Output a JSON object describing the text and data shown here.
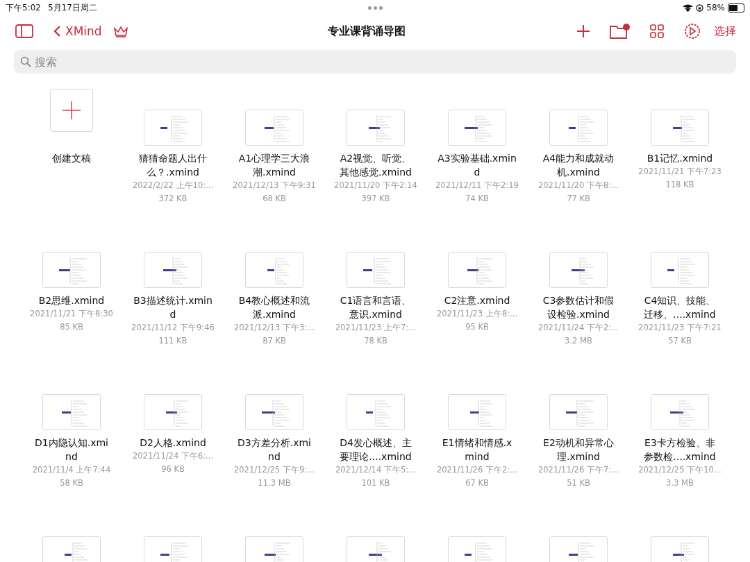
{
  "status_bar": {
    "time": "下午5:02",
    "date": "5月17日周二",
    "battery": "58%"
  },
  "nav": {
    "back_label": "XMind",
    "title": "专业课背诵导图",
    "select_label": "选择"
  },
  "search": {
    "placeholder": "搜索"
  },
  "create": {
    "label": "创建文稿"
  },
  "files": [
    {
      "kind": "file",
      "name": "猜猜命题人出什么？.xmind",
      "date": "2022/2/22 上午10:...",
      "size": "372 KB"
    },
    {
      "kind": "file",
      "name": "A1心理学三大浪潮.xmind",
      "date": "2021/12/13 下午9:31",
      "size": "68 KB"
    },
    {
      "kind": "file",
      "name": "A2视觉、听觉、其他感觉.xmind",
      "date": "2021/11/20 下午2:14",
      "size": "397 KB"
    },
    {
      "kind": "file",
      "name": "A3实验基础.xmind",
      "date": "2021/12/11 下午2:19",
      "size": "74 KB"
    },
    {
      "kind": "file",
      "name": "A4能力和成就动机.xmind",
      "date": "2021/11/20 下午8:...",
      "size": "77 KB"
    },
    {
      "kind": "file",
      "name": "B1记忆.xmind",
      "date": "2021/11/21 下午7:23",
      "size": "118 KB"
    },
    {
      "kind": "file",
      "name": "B2思维.xmind",
      "date": "2021/11/21 下午8:30",
      "size": "85 KB"
    },
    {
      "kind": "file",
      "name": "B3描述统计.xmind",
      "date": "2021/11/12 下午9:46",
      "size": "111 KB"
    },
    {
      "kind": "file",
      "name": "B4教心概述和流派.xmind",
      "date": "2021/12/13 下午3:...",
      "size": "87 KB"
    },
    {
      "kind": "file",
      "name": "C1语言和言语、意识.xmind",
      "date": "2021/11/23 上午7:...",
      "size": "78 KB"
    },
    {
      "kind": "file",
      "name": "C2注意.xmind",
      "date": "2021/11/23 上午8:...",
      "size": "95 KB"
    },
    {
      "kind": "file",
      "name": "C3参数估计和假设检验.xmind",
      "date": "2021/11/24 下午2:...",
      "size": "3.2 MB"
    },
    {
      "kind": "file",
      "name": "C4知识、技能、迁移、....xmind",
      "date": "2021/11/23 下午7:21",
      "size": "57 KB"
    },
    {
      "kind": "file",
      "name": "D1内隐认知.xmind",
      "date": "2021/11/4 上午7:44",
      "size": "58 KB"
    },
    {
      "kind": "file",
      "name": "D2人格.xmind",
      "date": "2021/11/24 下午6:...",
      "size": "96 KB"
    },
    {
      "kind": "file",
      "name": "D3方差分析.xmind",
      "date": "2021/12/25 下午9:...",
      "size": "11.3 MB"
    },
    {
      "kind": "file",
      "name": "D4发心概述、主要理论....xmind",
      "date": "2021/12/14 下午5:...",
      "size": "101 KB"
    },
    {
      "kind": "file",
      "name": "E1情绪和情感.xmind",
      "date": "2021/11/26 下午2:...",
      "size": "67 KB"
    },
    {
      "kind": "file",
      "name": "E2动机和异常心理.xmind",
      "date": "2021/11/26 下午7:...",
      "size": "51 KB"
    },
    {
      "kind": "file",
      "name": "E3卡方检验、非参数检....xmind",
      "date": "2021/12/25 下午10...",
      "size": "3.3 MB"
    },
    {
      "kind": "cut"
    },
    {
      "kind": "cut"
    },
    {
      "kind": "cut"
    },
    {
      "kind": "cut"
    },
    {
      "kind": "cut"
    },
    {
      "kind": "cut"
    },
    {
      "kind": "cut"
    }
  ]
}
